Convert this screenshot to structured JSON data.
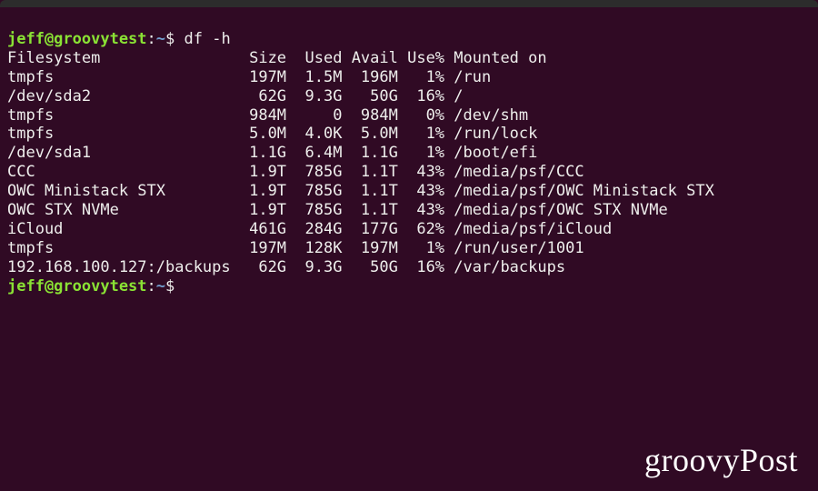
{
  "prompt": {
    "user": "jeff",
    "host": "groovytest",
    "path": "~",
    "symbol": "$"
  },
  "command": "df -h",
  "header": {
    "fs": "Filesystem",
    "size": "Size",
    "used": "Used",
    "avail": "Avail",
    "usep": "Use%",
    "mount": "Mounted on"
  },
  "rows": [
    {
      "fs": "tmpfs",
      "size": "197M",
      "used": "1.5M",
      "avail": "196M",
      "usep": "1%",
      "mount": "/run"
    },
    {
      "fs": "/dev/sda2",
      "size": "62G",
      "used": "9.3G",
      "avail": "50G",
      "usep": "16%",
      "mount": "/"
    },
    {
      "fs": "tmpfs",
      "size": "984M",
      "used": "0",
      "avail": "984M",
      "usep": "0%",
      "mount": "/dev/shm"
    },
    {
      "fs": "tmpfs",
      "size": "5.0M",
      "used": "4.0K",
      "avail": "5.0M",
      "usep": "1%",
      "mount": "/run/lock"
    },
    {
      "fs": "/dev/sda1",
      "size": "1.1G",
      "used": "6.4M",
      "avail": "1.1G",
      "usep": "1%",
      "mount": "/boot/efi"
    },
    {
      "fs": "CCC",
      "size": "1.9T",
      "used": "785G",
      "avail": "1.1T",
      "usep": "43%",
      "mount": "/media/psf/CCC"
    },
    {
      "fs": "OWC Ministack STX",
      "size": "1.9T",
      "used": "785G",
      "avail": "1.1T",
      "usep": "43%",
      "mount": "/media/psf/OWC Ministack STX"
    },
    {
      "fs": "OWC STX NVMe",
      "size": "1.9T",
      "used": "785G",
      "avail": "1.1T",
      "usep": "43%",
      "mount": "/media/psf/OWC STX NVMe"
    },
    {
      "fs": "iCloud",
      "size": "461G",
      "used": "284G",
      "avail": "177G",
      "usep": "62%",
      "mount": "/media/psf/iCloud"
    },
    {
      "fs": "tmpfs",
      "size": "197M",
      "used": "128K",
      "avail": "197M",
      "usep": "1%",
      "mount": "/run/user/1001"
    },
    {
      "fs": "192.168.100.127:/backups",
      "size": "62G",
      "used": "9.3G",
      "avail": "50G",
      "usep": "16%",
      "mount": "/var/backups"
    }
  ],
  "watermark": "groovyPost",
  "cols": {
    "fs": 25,
    "size": 5,
    "used": 6,
    "avail": 6,
    "usep": 5
  }
}
